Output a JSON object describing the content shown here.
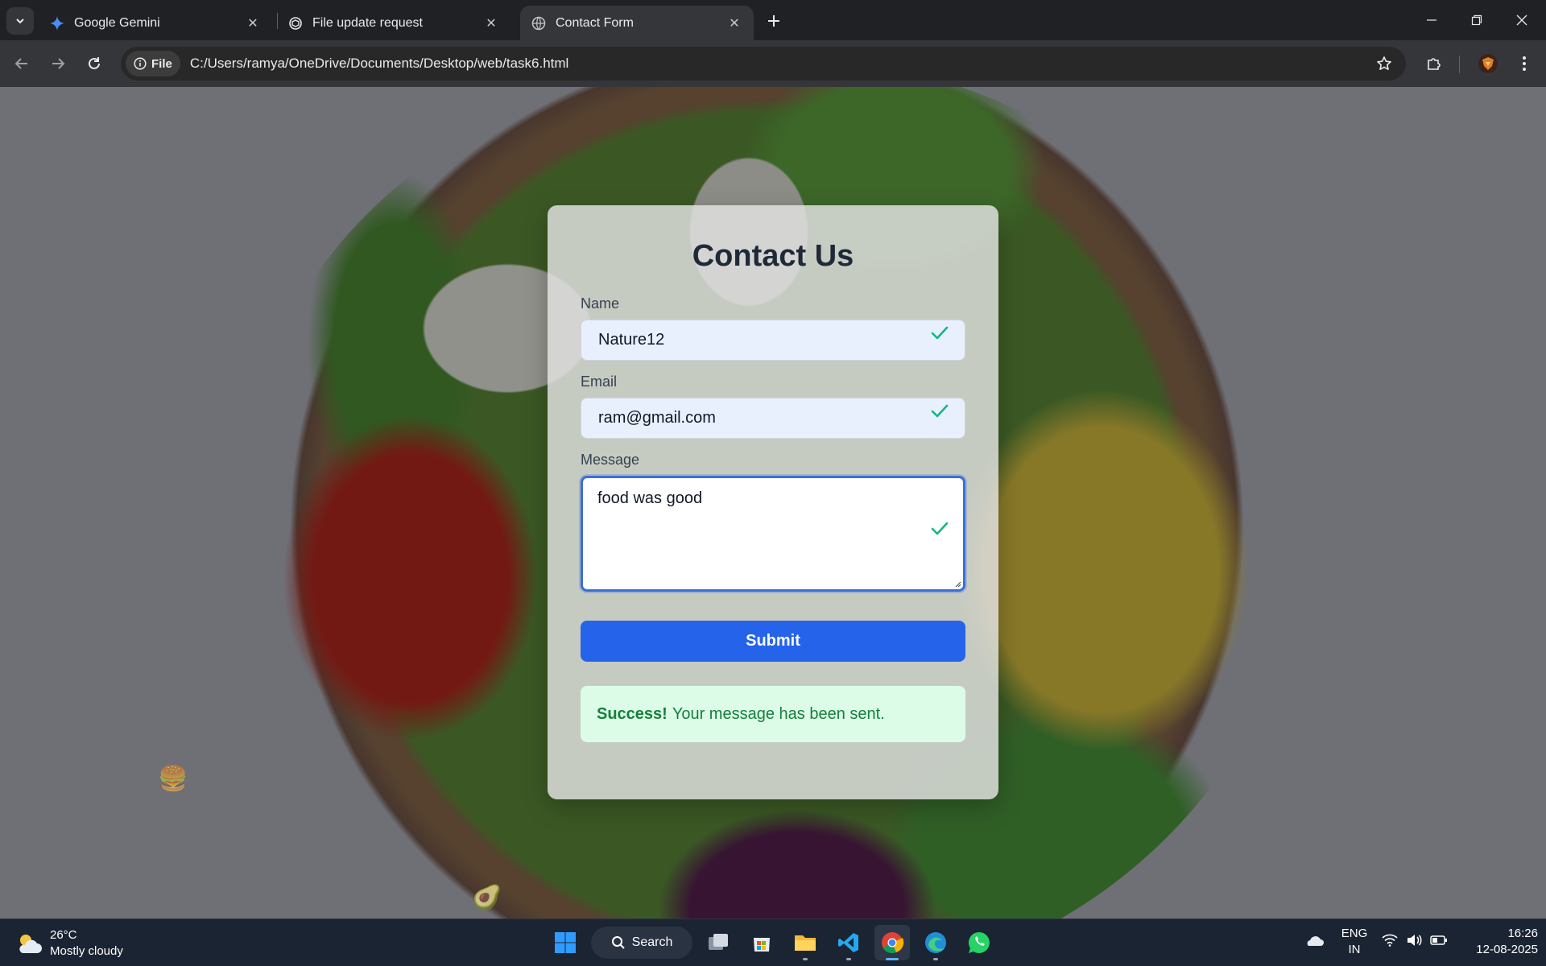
{
  "browser": {
    "tabs": [
      {
        "title": "Google Gemini",
        "icon": "gemini-icon",
        "active": false
      },
      {
        "title": "File update request",
        "icon": "openai-icon",
        "active": false
      },
      {
        "title": "Contact Form",
        "icon": "globe-icon",
        "active": true
      }
    ],
    "address": {
      "chip_label": "File",
      "url": "C:/Users/ramya/OneDrive/Documents/Desktop/web/task6.html"
    }
  },
  "form": {
    "title": "Contact Us",
    "name_label": "Name",
    "name_value": "Nature12",
    "email_label": "Email",
    "email_value": "ram@gmail.com",
    "message_label": "Message",
    "message_value": "food was good",
    "submit_label": "Submit",
    "success_strong": "Success!",
    "success_text": "Your message has been sent."
  },
  "colors": {
    "primary": "#2563eb",
    "success_bg": "#dcfce7",
    "success_text": "#15803d",
    "check": "#10b981"
  },
  "taskbar": {
    "weather_temp": "26°C",
    "weather_desc": "Mostly cloudy",
    "search_label": "Search",
    "lang_top": "ENG",
    "lang_bottom": "IN",
    "time": "16:26",
    "date": "12-08-2025"
  }
}
